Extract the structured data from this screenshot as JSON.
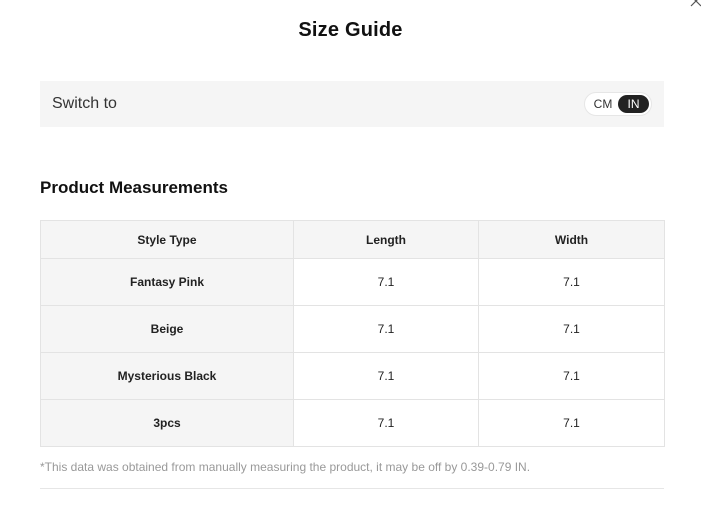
{
  "dialog": {
    "title": "Size Guide",
    "close_icon": "close-icon"
  },
  "switcher": {
    "label": "Switch to",
    "options": [
      "CM",
      "IN"
    ],
    "selected": "IN"
  },
  "measurements": {
    "title": "Product Measurements",
    "headers": [
      "Style Type",
      "Length",
      "Width"
    ],
    "rows": [
      {
        "style": "Fantasy Pink",
        "length": "7.1",
        "width": "7.1"
      },
      {
        "style": "Beige",
        "length": "7.1",
        "width": "7.1"
      },
      {
        "style": "Mysterious Black",
        "length": "7.1",
        "width": "7.1"
      },
      {
        "style": "3pcs",
        "length": "7.1",
        "width": "7.1"
      }
    ],
    "note": "*This data was obtained from manually measuring the product, it may be off by 0.39-0.79 IN."
  },
  "colors": {
    "accent": "#222222",
    "header_bg": "#f5f5f5",
    "border": "#e3e3e3",
    "note_text": "#999999"
  }
}
